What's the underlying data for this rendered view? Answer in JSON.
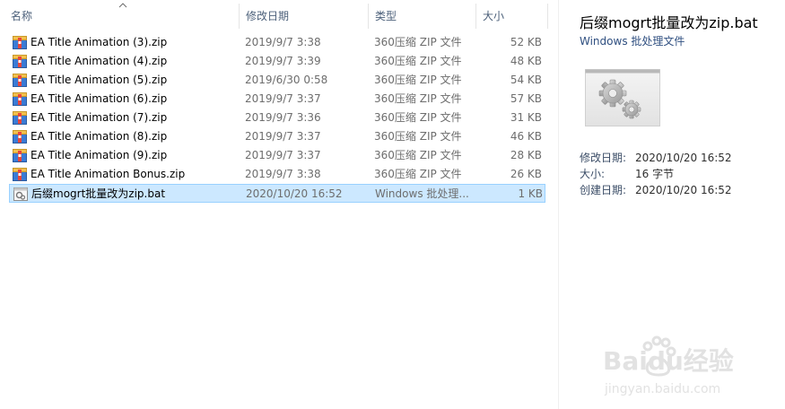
{
  "headers": {
    "name": "名称",
    "date": "修改日期",
    "type": "类型",
    "size": "大小"
  },
  "files": [
    {
      "name": "EA Title Animation (3).zip",
      "date": "2019/9/7 3:38",
      "type": "360压缩 ZIP 文件",
      "size": "52 KB",
      "icon": "zip-archive-icon"
    },
    {
      "name": "EA Title Animation (4).zip",
      "date": "2019/9/7 3:39",
      "type": "360压缩 ZIP 文件",
      "size": "48 KB",
      "icon": "zip-archive-icon"
    },
    {
      "name": "EA Title Animation (5).zip",
      "date": "2019/6/30 0:58",
      "type": "360压缩 ZIP 文件",
      "size": "54 KB",
      "icon": "zip-archive-icon"
    },
    {
      "name": "EA Title Animation (6).zip",
      "date": "2019/9/7 3:37",
      "type": "360压缩 ZIP 文件",
      "size": "57 KB",
      "icon": "zip-archive-icon"
    },
    {
      "name": "EA Title Animation (7).zip",
      "date": "2019/9/7 3:36",
      "type": "360压缩 ZIP 文件",
      "size": "31 KB",
      "icon": "zip-archive-icon"
    },
    {
      "name": "EA Title Animation (8).zip",
      "date": "2019/9/7 3:37",
      "type": "360压缩 ZIP 文件",
      "size": "46 KB",
      "icon": "zip-archive-icon"
    },
    {
      "name": "EA Title Animation (9).zip",
      "date": "2019/9/7 3:37",
      "type": "360压缩 ZIP 文件",
      "size": "28 KB",
      "icon": "zip-archive-icon"
    },
    {
      "name": "EA Title Animation Bonus.zip",
      "date": "2019/9/7 3:38",
      "type": "360压缩 ZIP 文件",
      "size": "26 KB",
      "icon": "zip-archive-icon"
    },
    {
      "name": "后缀mogrt批量改为zip.bat",
      "date": "2020/10/20 16:52",
      "type": "Windows 批处理...",
      "size": "1 KB",
      "icon": "batch-file-icon",
      "selected": true
    }
  ],
  "preview": {
    "title": "后缀mogrt批量改为zip.bat",
    "subtitle": "Windows 批处理文件",
    "thumbnail_icon": "gears-icon",
    "meta": [
      {
        "key": "修改日期:",
        "value": "2020/10/20 16:52"
      },
      {
        "key": "大小:",
        "value": "16 字节"
      },
      {
        "key": "创建日期:",
        "value": "2020/10/20 16:52"
      }
    ]
  },
  "watermark": {
    "text": "Baidu经验",
    "url": "jingyan.baidu.com"
  },
  "colors": {
    "selection_bg": "#cce8ff",
    "selection_border": "#99d1ff",
    "header_text": "#4c607a",
    "secondary_text": "#6d6d6d"
  }
}
